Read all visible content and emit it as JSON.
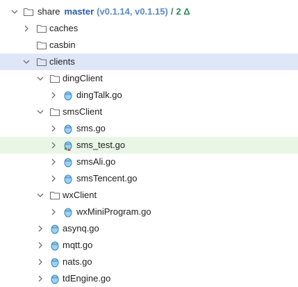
{
  "tree": {
    "root": {
      "name": "share",
      "branch": "master",
      "tags": "(v0.1.14, v0.1.15)",
      "separator": "/",
      "changes": "2 Δ"
    },
    "items": [
      {
        "name": "caches",
        "type": "folder",
        "expanded": false
      },
      {
        "name": "casbin",
        "type": "folder",
        "expanded": null
      },
      {
        "name": "clients",
        "type": "folder",
        "expanded": true,
        "selected": true
      },
      {
        "name": "dingClient",
        "type": "folder",
        "expanded": true
      },
      {
        "name": "dingTalk.go",
        "type": "go-file"
      },
      {
        "name": "smsClient",
        "type": "folder",
        "expanded": true
      },
      {
        "name": "sms.go",
        "type": "go-file"
      },
      {
        "name": "sms_test.go",
        "type": "go-test-file",
        "modified": true
      },
      {
        "name": "smsAli.go",
        "type": "go-file"
      },
      {
        "name": "smsTencent.go",
        "type": "go-file"
      },
      {
        "name": "wxClient",
        "type": "folder",
        "expanded": true
      },
      {
        "name": "wxMiniProgram.go",
        "type": "go-file"
      },
      {
        "name": "asynq.go",
        "type": "go-file"
      },
      {
        "name": "mqtt.go",
        "type": "go-file"
      },
      {
        "name": "nats.go",
        "type": "go-file"
      },
      {
        "name": "tdEngine.go",
        "type": "go-file"
      }
    ]
  },
  "colors": {
    "selected_row": "#dfe6f8",
    "modified_row": "#e9f6e5",
    "branch": "#2b5aa8",
    "tags": "#5a88c9",
    "changes": "#2e8b57",
    "go_icon": "#4aa3df"
  }
}
